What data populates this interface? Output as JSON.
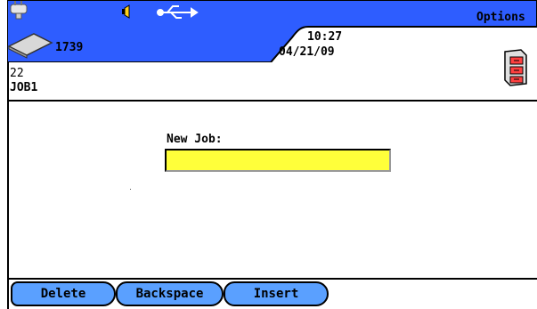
{
  "header": {
    "options_label": "Options",
    "counter": "1739",
    "time": "10:27",
    "date": "04/21/09",
    "icons": [
      "power-plug-icon",
      "speaker-icon",
      "usb-icon",
      "storage-disk-icon",
      "file-cabinet-icon"
    ],
    "bar_color": "#2e5dff"
  },
  "main": {
    "line_one": "22",
    "line_two": "JOB1",
    "new_job_label": "New Job:",
    "new_job_value": "",
    "input_color": "#ffff3a"
  },
  "softkeys": {
    "delete": "Delete",
    "backspace": "Backspace",
    "insert": "Insert",
    "color": "#5aa0ff"
  }
}
